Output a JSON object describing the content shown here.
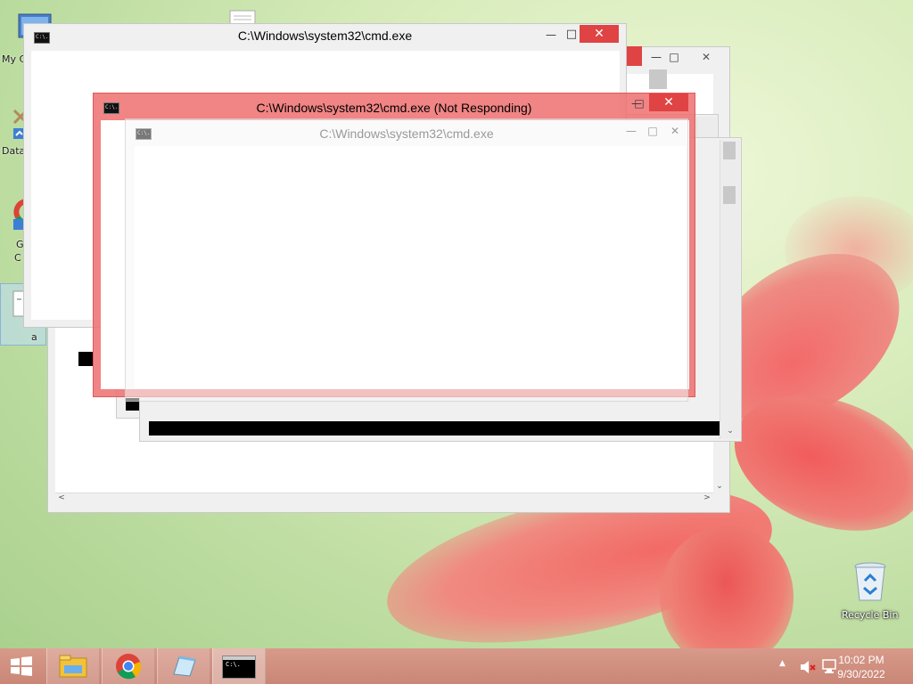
{
  "desktop": {
    "icons": [
      {
        "label": "My C"
      },
      {
        "label": "Data"
      },
      {
        "label": "G"
      },
      {
        "label": "C"
      },
      {
        "label": "a"
      },
      {
        "label": "Recycle Bin"
      }
    ]
  },
  "windows": {
    "cmd_top": {
      "title": "C:\\Windows\\system32\\cmd.exe"
    },
    "cmd_not_responding": {
      "title": "C:\\Windows\\system32\\cmd.exe (Not Responding)"
    },
    "cmd_ghost": {
      "title": "C:\\Windows\\system32\\cmd.exe"
    },
    "icon_text": "C:\\."
  },
  "taskbar": {
    "clock_time": "10:02 PM",
    "clock_date": "9/30/2022",
    "icons": [
      "windows-start-icon",
      "file-explorer-icon",
      "chrome-icon",
      "notepad-icon",
      "cmd-icon"
    ],
    "tray_icons": [
      "show-hidden-icons-arrow",
      "speaker-muted-icon",
      "network-icon"
    ]
  },
  "colors": {
    "accent_close": "#e04343",
    "not_responding_frame": "#f08080",
    "taskbar": "#cf8e7e"
  }
}
